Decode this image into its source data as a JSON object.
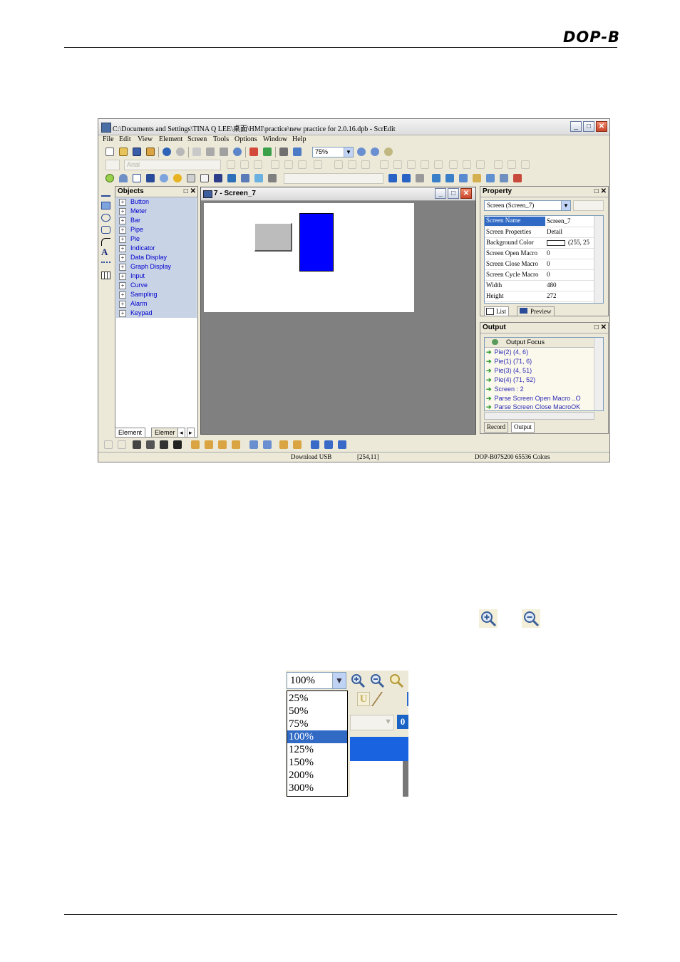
{
  "header": {
    "brand": "DOP-B"
  },
  "window": {
    "title": "C:\\Documents and Settings\\TINA Q LEE\\桌面\\HMI\\practice\\new practice for 2.0.16.dpb - ScrEdit",
    "menu": [
      "File",
      "Edit",
      "View",
      "Element",
      "Screen",
      "Tools",
      "Options",
      "Window",
      "Help"
    ],
    "zoom_value": "75%",
    "font_name": "Arial",
    "objects_panel": {
      "title": "Objects",
      "items": [
        "Button",
        "Meter",
        "Bar",
        "Pipe",
        "Pie",
        "Indicator",
        "Data Display",
        "Graph Display",
        "Input",
        "Curve",
        "Sampling",
        "Alarm",
        "Keypad"
      ],
      "tabs": [
        "Element",
        "Elemer"
      ]
    },
    "screen_window": {
      "title": "7 - Screen_7"
    },
    "property_panel": {
      "title": "Property",
      "selector": "Screen (Screen_7)",
      "rows": [
        {
          "key": "Screen Name",
          "value": "Screen_7"
        },
        {
          "key": "Screen Properties",
          "value": "Detail"
        },
        {
          "key": "Background Color",
          "value": "(255, 25"
        },
        {
          "key": "Screen Open Macro",
          "value": "0"
        },
        {
          "key": "Screen Close Macro",
          "value": "0"
        },
        {
          "key": "Screen Cycle Macro",
          "value": "0"
        },
        {
          "key": "Width",
          "value": "480"
        },
        {
          "key": "Height",
          "value": "272"
        }
      ],
      "tabs": [
        "List",
        "Preview"
      ]
    },
    "output_panel": {
      "title": "Output",
      "focus_label": "Output Focus",
      "lines": [
        "Pie(2) (4, 6)",
        "Pie(1) (71, 6)",
        "Pie(3) (4, 51)",
        "Pie(4) (71, 52)",
        "Screen : 2",
        "Parse Screen Open Macro ..O",
        "Parse Screen Close MacroOK"
      ],
      "tabs": [
        "Record",
        "Output"
      ]
    },
    "status": {
      "connection": "Download USB",
      "coords": "[254,11]",
      "model": "DOP-B07S200 65536 Colors"
    }
  },
  "zoom_popup": {
    "value": "100%",
    "options": [
      "25%",
      "50%",
      "75%",
      "100%",
      "125%",
      "150%",
      "200%",
      "300%"
    ],
    "selected_index": 3
  }
}
